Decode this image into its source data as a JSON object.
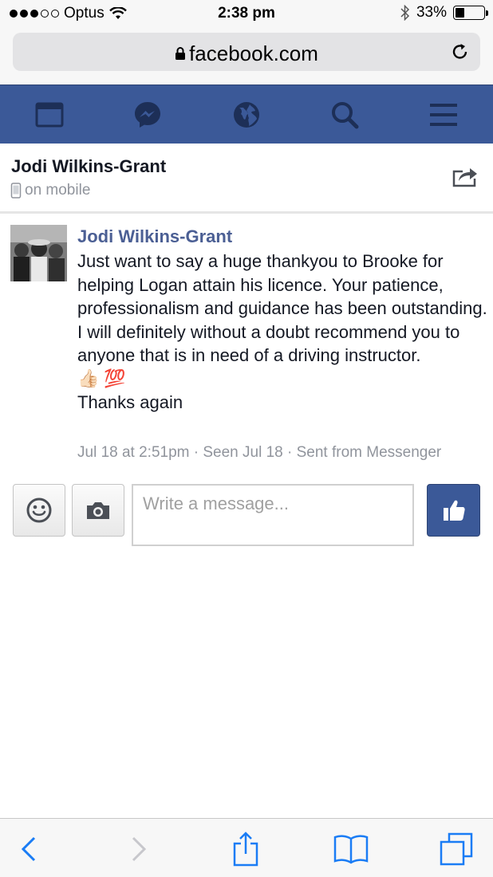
{
  "status": {
    "carrier": "Optus",
    "time": "2:38 pm",
    "battery": "33%",
    "battery_level": 0.33,
    "signal_bars_filled": 3,
    "signal_bars_total": 5
  },
  "browser": {
    "url": "facebook.com"
  },
  "nav": {
    "icons": [
      "feed-icon",
      "messenger-icon",
      "globe-icon",
      "search-icon",
      "menu-icon"
    ]
  },
  "conversation": {
    "name": "Jodi Wilkins-Grant",
    "status": "on mobile"
  },
  "message": {
    "sender": "Jodi Wilkins-Grant",
    "body": "Just want to say a huge thankyou to Brooke for helping Logan attain his licence. Your patience, professionalism and guidance has been outstanding.\nI will definitely without a doubt recommend you to anyone that is in need of a driving instructor.",
    "emojis": [
      "👍🏻",
      "💯"
    ],
    "closing": "Thanks again",
    "meta": "Jul 18 at 2:51pm · Seen Jul 18 · Sent from Messenger"
  },
  "composer": {
    "placeholder": "Write a message..."
  },
  "colors": {
    "fb_blue": "#3b5998",
    "name_blue": "#4b5f94",
    "ios_blue": "#1a7cf5",
    "meta_gray": "#90949c"
  }
}
